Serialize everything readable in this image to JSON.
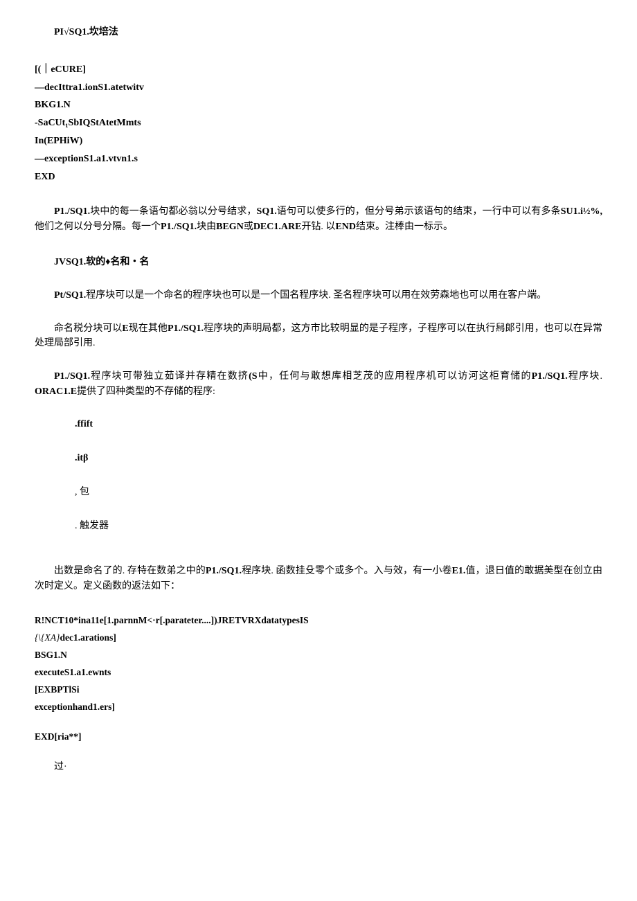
{
  "heading1": "PI√SQ1.坎培法",
  "code1": {
    "l1": "[(｜eCURE]",
    "l2": "—decIttra1.ionS1.atetwitv",
    "l3": "BKG1.N",
    "l4": "-SaCUt₁SbIQStAtetMmts",
    "l5": "In(EPHiW)",
    "l6": "—exceptionS1.a1.vtvn1.s",
    "l7": "EXD"
  },
  "para1_pre": "P1./SQ1.",
  "para1_mid1": "块中的每一条语句都必翁以分号结求，",
  "para1_sq1": "SQ1.",
  "para1_mid2": "语句可以使多行的，但分号弟示该语句的结束，一行中可以有多条",
  "para1_su": "SU1.i½%,",
  "para1_mid3": " 他们之何以分号分隔。每一个",
  "para1_p1": "P1./SQ1.",
  "para1_mid4": "块由",
  "para1_begn": "BEGN",
  "para1_or": "或",
  "para1_dec": "DEC1.ARE",
  "para1_mid5": "开钻. 以",
  "para1_end": "END",
  "para1_tail": "结束。注棒由一标示。",
  "heading2": "JVSQ1.软的♦名和・名",
  "para2_pre": "Pt/SQ1.",
  "para2_body": "程序块可以是一个命名的程序块也可以是一个国名程序块. 圣名程序块可以用在效劳森地也可以用在客户端。",
  "para3_pre": "命名税分块可以",
  "para3_e": "E",
  "para3_mid1": "现在其他",
  "para3_p1": "P1./SQ1.",
  "para3_tail": "程序块的声明局都，这方市比较明显的是子程序，子程序可以在执行舄郞引用，也可以在异常处理局部引用.",
  "para4_p1a": "P1./SQ1.",
  "para4_mid1": "程序块可带独立茹译并存精在数挤",
  "para4_s": "(S",
  "para4_mid2": "中，任何与敢想库相芝茂的应用程序机可以访河这柜育储的",
  "para4_p1b": "P1./SQ1.",
  "para4_mid3": "程序块. ",
  "para4_orac": "ORAC1.E",
  "para4_tail": "提供了四种类型的不存储的程序:",
  "list": {
    "i1": ".ffift",
    "i2": ".itβ",
    "i3": ", 包",
    "i4": ". 触发器"
  },
  "para5_pre": "出数是命名了的. 存特在数弟之中的",
  "para5_p1": "P1./SQ1.",
  "para5_mid": "程序块. 函数挂殳零个或多个。入与效，有一小卷",
  "para5_e1": "E1.",
  "para5_tail": "值，退日值的敢据美型在创立由次时定义。定义函数的返法如下：",
  "code2": {
    "l1": "R!NCT10*ina11e[1.parnnM<·r[.parateter....])JRETVRXdatatypesIS",
    "l2a": "{\\{XA}",
    "l2b": "dec1.arations]",
    "l3": "BSG1.N",
    "l4": "executeS1.a1.ewnts",
    "l5": "[EXBPTlSi",
    "l6": "exceptionhand1.ers]",
    "l7": "EXD[ria**]"
  },
  "tail": "过·"
}
